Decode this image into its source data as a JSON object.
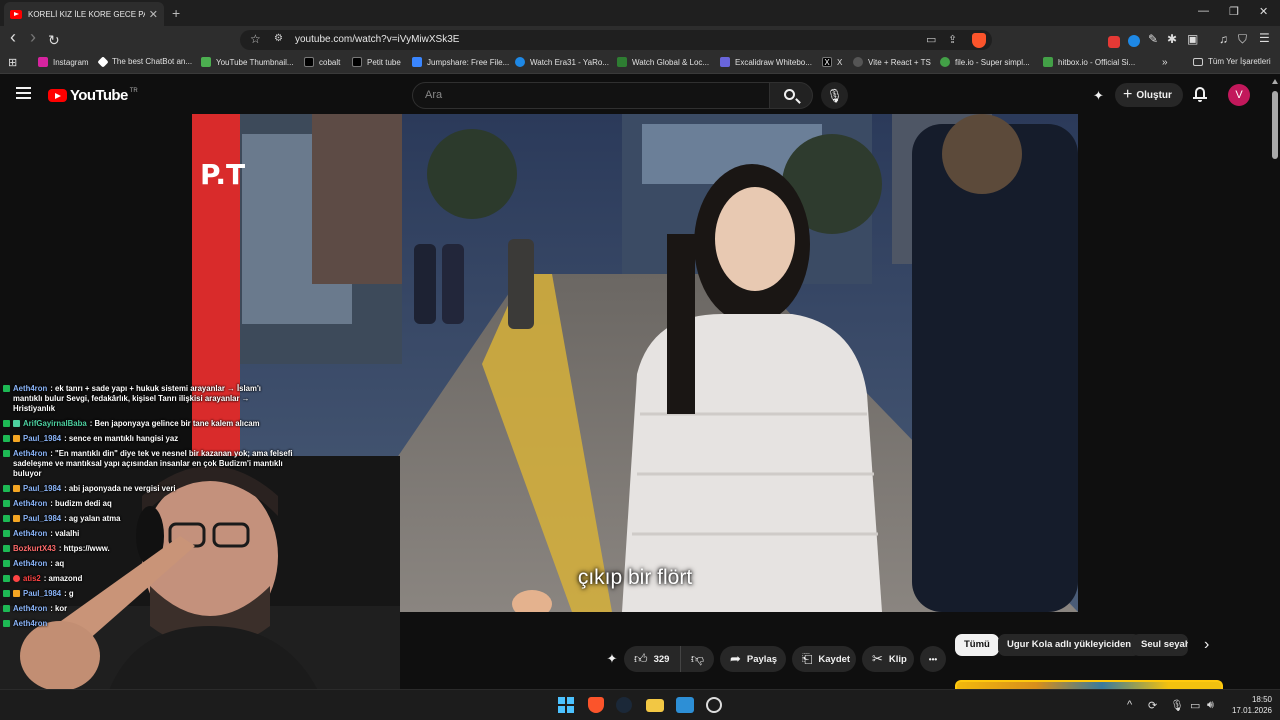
{
  "browser": {
    "tab_title": "KORELİ KIZ İLE KORE GECE PA",
    "tab_close": "✕",
    "new_tab": "+",
    "window_controls": {
      "minimize": "—",
      "maximize": "❐",
      "close": "✕"
    },
    "url": "youtube.com/watch?v=iVyMiwXSk3E",
    "nav": {
      "back": "‹",
      "forward": "›",
      "reload": "↻"
    },
    "bookmarks": [
      {
        "label": "Instagram",
        "icon": "instagram-icon",
        "color": "#d6249f"
      },
      {
        "label": "The best ChatBot an...",
        "icon": "chatbot-icon",
        "color": "#ffffff"
      },
      {
        "label": "YouTube Thumbnail...",
        "icon": "thumbnail-icon",
        "color": "#4caf50"
      },
      {
        "label": "cobalt",
        "icon": "cobalt-icon",
        "color": "#000000"
      },
      {
        "label": "Petit tube",
        "icon": "petit-tube-icon",
        "color": "#000000"
      },
      {
        "label": "Jumpshare: Free File...",
        "icon": "jumpshare-icon",
        "color": "#3a86ff"
      },
      {
        "label": "Watch Era31 - YaRo...",
        "icon": "era31-icon",
        "color": "#1e88e5"
      },
      {
        "label": "Watch Global & Loc...",
        "icon": "watch-global-icon",
        "color": "#2e7d32"
      },
      {
        "label": "Excalidraw Whitebo...",
        "icon": "excalidraw-icon",
        "color": "#6965db"
      },
      {
        "label": "X",
        "icon": "x-icon",
        "color": "#000000"
      },
      {
        "label": "Vite + React + TS",
        "icon": "vite-icon",
        "color": "#555555"
      },
      {
        "label": "file.io - Super simpl...",
        "icon": "fileio-icon",
        "color": "#43a047"
      },
      {
        "label": "hitbox.io - Official Si...",
        "icon": "hitbox-icon",
        "color": "#43a047"
      }
    ],
    "bookmarks_overflow": "»",
    "all_bookmarks": "Tüm Yer İşaretleri"
  },
  "youtube": {
    "logo_text": "YouTube",
    "logo_region": "TR",
    "search_placeholder": "Ara",
    "create_label": "Oluştur",
    "avatar_letter": "V",
    "subtitle": "çıkıp bir flört",
    "like_count": "329",
    "share_label": "Paylaş",
    "save_label": "Kaydet",
    "clip_label": "Klip",
    "more_label": "•••",
    "chips": [
      "Tümü",
      "Ugur Kola adlı yükleyiciden",
      "Seul seyah"
    ],
    "chip_next": "›",
    "brand_red": "#ff0000"
  },
  "chat": [
    {
      "user": "Aeth4ron",
      "color": "#8ab4f8",
      "text": ": ek tanrı + sade yapı + hukuk sistemi arayanlar → İslam'ı mantıklı bulur Sevgi, fedakârlık, kişisel Tanrı ilişkisi arayanlar → Hristiyanlık"
    },
    {
      "user": "ArifGayirnalBaba",
      "color": "#4dd0a0",
      "text": ": Ben japonyaya gelince bir tane kalem alıcam"
    },
    {
      "user": "Paul_1984",
      "color": "#8ab4f8",
      "text": ": sence en mantıklı hangisi yaz"
    },
    {
      "user": "Aeth4ron",
      "color": "#8ab4f8",
      "text": ": \"En mantıklı din\" diye tek ve nesnel bir kazanan yok; ama felsefi sadeleşme ve mantıksal yapı açısından insanlar en çok Budizm'i mantıklı buluyor"
    },
    {
      "user": "Paul_1984",
      "color": "#8ab4f8",
      "text": ": abi japonyada ne vergisi veri"
    },
    {
      "user": "Aeth4ron",
      "color": "#8ab4f8",
      "text": ": budizm dedi aq"
    },
    {
      "user": "Paul_1984",
      "color": "#8ab4f8",
      "text": ": ag yalan atma"
    },
    {
      "user": "Aeth4ron",
      "color": "#8ab4f8",
      "text": ": valalhi"
    },
    {
      "user": "BozkurtX43",
      "color": "#ff6b6b",
      "text": ": https://www."
    },
    {
      "user": "Aeth4ron",
      "color": "#8ab4f8",
      "text": ": aq"
    },
    {
      "user": "atis2",
      "color": "#ff4444",
      "text": ": amazond"
    },
    {
      "user": "Paul_1984",
      "color": "#8ab4f8",
      "text": ": g"
    },
    {
      "user": "Aeth4ron",
      "color": "#8ab4f8",
      "text": ": kor"
    },
    {
      "user": "Aeth4ron",
      "color": "#8ab4f8",
      "text": ""
    }
  ],
  "taskbar": {
    "time": "18:50",
    "date": "17.01.2026",
    "tray_up": "^"
  }
}
